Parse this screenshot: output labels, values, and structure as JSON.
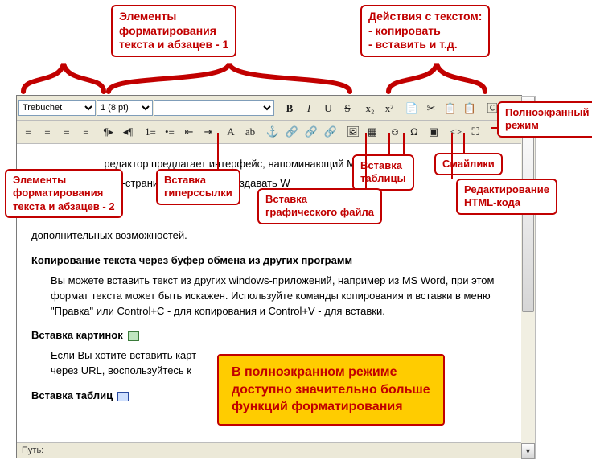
{
  "callouts": {
    "format1": "Элементы\nформатирования\nтекста и абзацев - 1",
    "textactions": "Действия с текстом:\n- копировать\n- вставить и т.д.",
    "fullscreen": "Полноэкранный\nрежим",
    "format2": "Элементы\nформатирования\nтекста и абзацев - 2",
    "hyperlink": "Вставка\nгиперссылки",
    "imgfile": "Вставка\nграфического файла",
    "table": "Вставка\nтаблицы",
    "smiley": "Смайлики",
    "htmledit": "Редактирование\nHTML-кода"
  },
  "toolbar": {
    "font_family": "Trebuchet",
    "font_size": "1 (8 pt)",
    "buttons_row1": [
      {
        "name": "bold-icon",
        "label": "B",
        "style": "font-weight:bold"
      },
      {
        "name": "italic-icon",
        "label": "I",
        "style": "font-style:italic"
      },
      {
        "name": "underline-icon",
        "label": "U",
        "style": "text-decoration:underline"
      },
      {
        "name": "strike-icon",
        "label": "S",
        "style": "text-decoration:line-through"
      },
      {
        "name": "sep"
      },
      {
        "name": "subscript-icon",
        "label": "x₂"
      },
      {
        "name": "superscript-icon",
        "label": "x²"
      },
      {
        "name": "sep"
      },
      {
        "name": "copy-icon",
        "label": "📄"
      },
      {
        "name": "cut-icon",
        "label": "✂"
      },
      {
        "name": "paste-icon",
        "label": "📋"
      },
      {
        "name": "paste-word-icon",
        "label": "📋"
      },
      {
        "name": "sep"
      },
      {
        "name": "clear-format-icon",
        "label": "🄲"
      }
    ],
    "buttons_row2": [
      {
        "name": "align-left-icon",
        "label": "≡"
      },
      {
        "name": "align-center-icon",
        "label": "≡"
      },
      {
        "name": "align-right-icon",
        "label": "≡"
      },
      {
        "name": "align-justify-icon",
        "label": "≡"
      },
      {
        "name": "sep"
      },
      {
        "name": "ltr-icon",
        "label": "¶▸"
      },
      {
        "name": "rtl-icon",
        "label": "◂¶"
      },
      {
        "name": "sep"
      },
      {
        "name": "ordered-list-icon",
        "label": "1≡"
      },
      {
        "name": "unordered-list-icon",
        "label": "•≡"
      },
      {
        "name": "outdent-icon",
        "label": "⇤"
      },
      {
        "name": "indent-icon",
        "label": "⇥"
      },
      {
        "name": "sep"
      },
      {
        "name": "font-color-icon",
        "label": "A"
      },
      {
        "name": "highlight-icon",
        "label": "ab"
      },
      {
        "name": "sep"
      },
      {
        "name": "anchor-icon",
        "label": "⚓"
      },
      {
        "name": "link-icon",
        "label": "🔗"
      },
      {
        "name": "unlink-icon",
        "label": "🔗"
      },
      {
        "name": "extlink-icon",
        "label": "🔗"
      },
      {
        "name": "sep"
      },
      {
        "name": "image-icon",
        "label": "🖼"
      },
      {
        "name": "table-icon",
        "label": "▦"
      },
      {
        "name": "sep"
      },
      {
        "name": "smiley-icon",
        "label": "☺"
      },
      {
        "name": "char-icon",
        "label": "Ω"
      },
      {
        "name": "template-icon",
        "label": "▣"
      },
      {
        "name": "sep"
      },
      {
        "name": "html-icon",
        "label": "<>"
      },
      {
        "name": "fullscreen-icon",
        "label": "⛶"
      }
    ]
  },
  "content": {
    "intro1": "редактор предлагает интерфейс, напоминающий М",
    "intro2": "встроенный в Web-страницу. Позволяет создавать W",
    "intro_end": "дополнительных возможностей.",
    "h_copy": "Копирование текста через буфер обмена из других программ",
    "p_copy": "Вы можете вставить текст из других windows-приложений, например из MS Word, при этом формат текста может быть искажен. Используйте команды копирования и вставки в меню \"Правка\" или Control+C - для копирования и Control+V - для вставки.",
    "h_img": "Вставка картинок",
    "p_img": "Если Вы хотите вставить карт\nчерез URL, воспользуйтесь к",
    "h_tbl": "Вставка таблиц"
  },
  "yellow_note": "В полноэкранном режиме\nдоступно значительно больше\nфункций форматирования",
  "status": "Путь:"
}
